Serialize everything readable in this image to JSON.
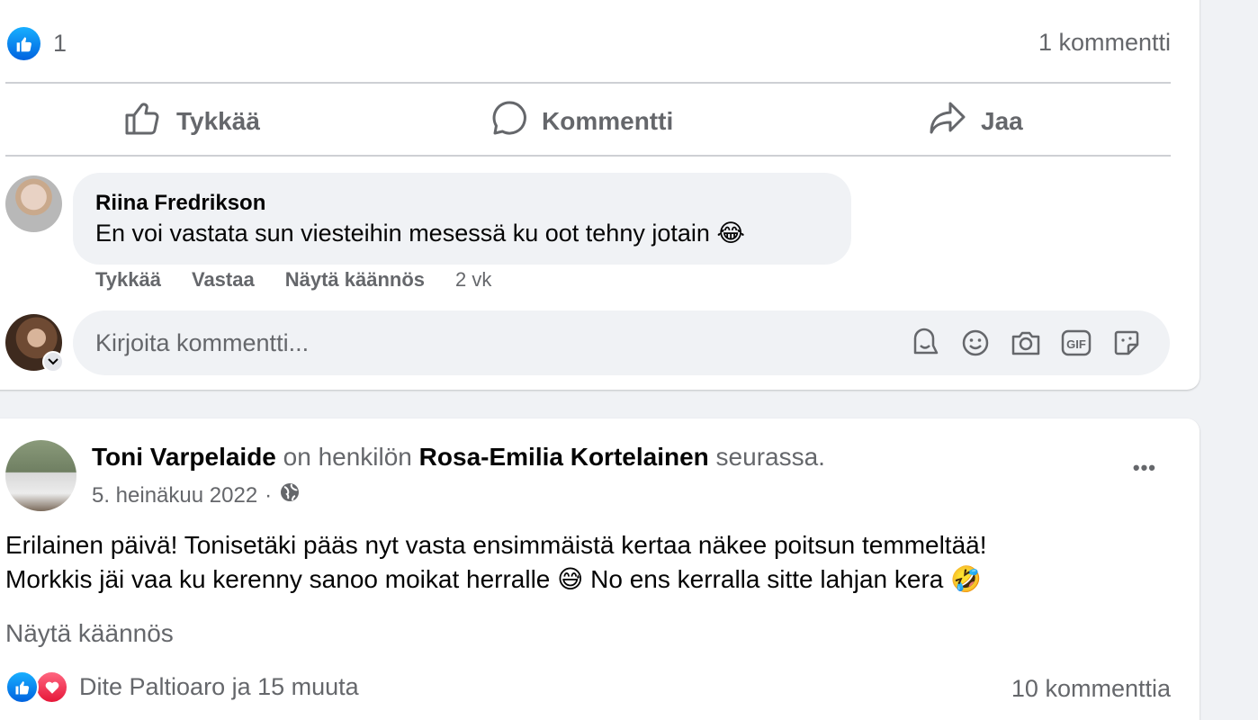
{
  "post1": {
    "reactions": {
      "count": "1",
      "comments_label": "1 kommentti"
    },
    "actions": {
      "like": "Tykkää",
      "comment": "Kommentti",
      "share": "Jaa"
    },
    "comment": {
      "author": "Riina Fredrikson",
      "text": "En voi vastata sun viesteihin mesessä ku oot tehny jotain",
      "emoji": "😂",
      "like_label": "Tykkää",
      "reply_label": "Vastaa",
      "translate_label": "Näytä käännös",
      "time": "2 vk"
    },
    "composer": {
      "placeholder": "Kirjoita kommentti...",
      "tools": [
        "avatar-sticker-icon",
        "emoji-icon",
        "camera-icon",
        "gif-icon",
        "sticker-icon"
      ]
    }
  },
  "post2": {
    "author": "Toni Varpelaide",
    "with_prefix": "on henkilön",
    "with_name": "Rosa-Emilia Kortelainen",
    "with_suffix": "seurassa.",
    "date": "5. heinäkuu 2022",
    "separator": "·",
    "audience_icon": "globe-icon",
    "body_line1": "Erilainen päivä! Tonisetäki pääs nyt vasta ensimmäistä kertaa näkee poitsun temmeltää!",
    "body_line2_a": "Morkkis jäi vaa ku kerenny sanoo moikat herralle",
    "emoji_sweat": "😅",
    "body_line2_b": "No ens kerralla sitte lahjan kera",
    "emoji_rofl": "🤣",
    "translate_label": "Näytä käännös",
    "reactions_text": "Dite Paltioaro ja 15 muuta",
    "comments_label": "10 kommenttia",
    "more_label": "•••"
  },
  "colors": {
    "page_bg": "#f0f2f5",
    "card_bg": "#ffffff",
    "muted_text": "#65676b",
    "like_blue": "#1877f2",
    "love_red": "#f33e58"
  }
}
